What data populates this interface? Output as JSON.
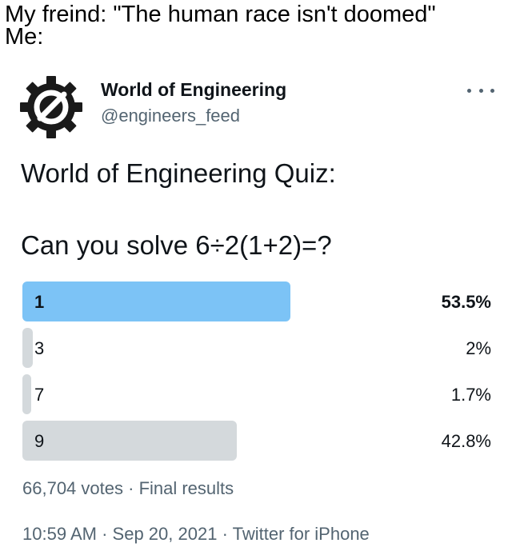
{
  "meme": {
    "line1": "My freind: \"The human race isn't doomed\"",
    "line2": "Me:"
  },
  "tweet": {
    "author": {
      "display_name": "World of Engineering",
      "handle": "@engineers_feed",
      "avatar_icon": "gear-logo-icon"
    },
    "more_icon": "more-options-icon",
    "text_line1": "World of Engineering Quiz:",
    "text_line2": "Can you solve 6÷2(1+2)=?",
    "poll": {
      "options": [
        {
          "label": "1",
          "percent_text": "53.5%",
          "percent": 53.5,
          "winner": true
        },
        {
          "label": "3",
          "percent_text": "2%",
          "percent": 2,
          "winner": false
        },
        {
          "label": "7",
          "percent_text": "1.7%",
          "percent": 1.7,
          "winner": false
        },
        {
          "label": "9",
          "percent_text": "42.8%",
          "percent": 42.8,
          "winner": false
        }
      ],
      "votes": "66,704 votes",
      "separator": "·",
      "status": "Final results"
    },
    "time": "10:59 AM",
    "date": "Sep 20, 2021",
    "source": "Twitter for iPhone"
  },
  "colors": {
    "winner_bar": "#7cc3f6",
    "other_bar": "#d4d9dc",
    "secondary_text": "#536471",
    "primary_text": "#0f1419",
    "logo": "#1a1a1a"
  }
}
